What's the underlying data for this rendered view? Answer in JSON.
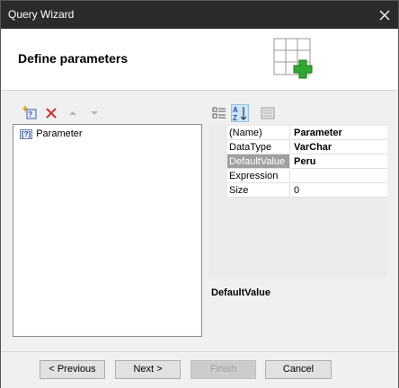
{
  "window": {
    "title": "Query Wizard",
    "close_icon": "close-icon"
  },
  "header": {
    "title": "Define parameters",
    "icon": "table-add-icon"
  },
  "left_toolbar": {
    "add_icon": "add-parameter-icon",
    "delete_icon": "delete-icon",
    "move_up_icon": "move-up-icon",
    "move_down_icon": "move-down-icon"
  },
  "parameters": [
    {
      "badge": "[?]",
      "label": "Parameter"
    }
  ],
  "right_toolbar": {
    "categorized_icon": "categorized-view-icon",
    "alphabetical_icon": "sort-alphabetical-icon",
    "property_pages_icon": "property-pages-icon"
  },
  "properties": [
    {
      "name": "(Name)",
      "value": "Parameter",
      "bold": true
    },
    {
      "name": "DataType",
      "value": "VarChar",
      "bold": true
    },
    {
      "name": "DefaultValue",
      "value": "Peru",
      "bold": true,
      "selected": true
    },
    {
      "name": "Expression",
      "value": "",
      "bold": false
    },
    {
      "name": "Size",
      "value": "0",
      "bold": false
    }
  ],
  "description": {
    "title": "DefaultValue"
  },
  "footer": {
    "previous_label": "< Previous",
    "next_label": "Next >",
    "finish_label": "Finish",
    "cancel_label": "Cancel"
  },
  "colors": {
    "titlebar": "#2b2b2b",
    "accent_green": "#2fa82f",
    "delete_red": "#d0312d",
    "selected_row": "#a0a0a0"
  }
}
